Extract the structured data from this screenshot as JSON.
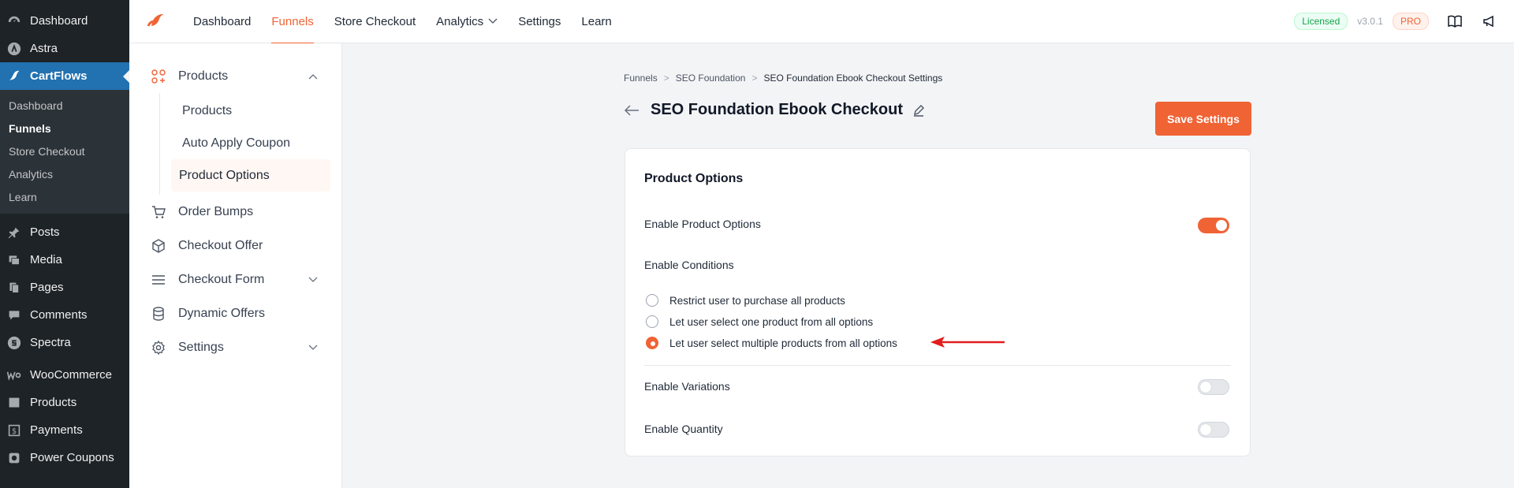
{
  "wp_menu": {
    "top": [
      {
        "label": "Dashboard",
        "icon": "dashboard-icon"
      },
      {
        "label": "Astra",
        "icon": "astra-icon"
      },
      {
        "label": "CartFlows",
        "icon": "cartflows-icon",
        "active": true
      }
    ],
    "sub": [
      "Dashboard",
      "Funnels",
      "Store Checkout",
      "Analytics",
      "Learn"
    ],
    "sub_current": "Funnels",
    "bottom_a": [
      {
        "label": "Posts",
        "icon": "pin-icon"
      },
      {
        "label": "Media",
        "icon": "media-icon"
      },
      {
        "label": "Pages",
        "icon": "pages-icon"
      },
      {
        "label": "Comments",
        "icon": "comments-icon"
      },
      {
        "label": "Spectra",
        "icon": "spectra-icon"
      }
    ],
    "bottom_b": [
      {
        "label": "WooCommerce",
        "icon": "woocommerce-icon"
      },
      {
        "label": "Products",
        "icon": "products-icon"
      },
      {
        "label": "Payments",
        "icon": "payments-icon"
      },
      {
        "label": "Power Coupons",
        "icon": "coupons-icon"
      }
    ]
  },
  "header": {
    "nav": [
      "Dashboard",
      "Funnels",
      "Store Checkout",
      "Analytics",
      "Settings",
      "Learn"
    ],
    "active": "Funnels",
    "licensed": "Licensed",
    "version": "v3.0.1",
    "pro": "PRO"
  },
  "settings_nav": {
    "products": "Products",
    "products_sub": [
      "Products",
      "Auto Apply Coupon",
      "Product Options"
    ],
    "products_sub_current": "Product Options",
    "order_bumps": "Order Bumps",
    "checkout_offer": "Checkout Offer",
    "checkout_form": "Checkout Form",
    "dynamic_offers": "Dynamic Offers",
    "settings": "Settings"
  },
  "breadcrumb": [
    "Funnels",
    "SEO Foundation",
    "SEO Foundation Ebook Checkout Settings"
  ],
  "page_title": "SEO Foundation Ebook Checkout",
  "save_label": "Save Settings",
  "card": {
    "title": "Product Options",
    "enable_product_options": "Enable Product Options",
    "enable_product_options_on": true,
    "enable_conditions": "Enable Conditions",
    "conditions": [
      {
        "label": "Restrict user to purchase all products",
        "checked": false
      },
      {
        "label": "Let user select one product from all options",
        "checked": false
      },
      {
        "label": "Let user select multiple products from all options",
        "checked": true
      }
    ],
    "enable_variations": "Enable Variations",
    "enable_variations_on": false,
    "enable_quantity": "Enable Quantity",
    "enable_quantity_on": false
  },
  "colors": {
    "accent": "#f06335",
    "wp_bg": "#1d2327",
    "wp_active": "#2271b1"
  }
}
